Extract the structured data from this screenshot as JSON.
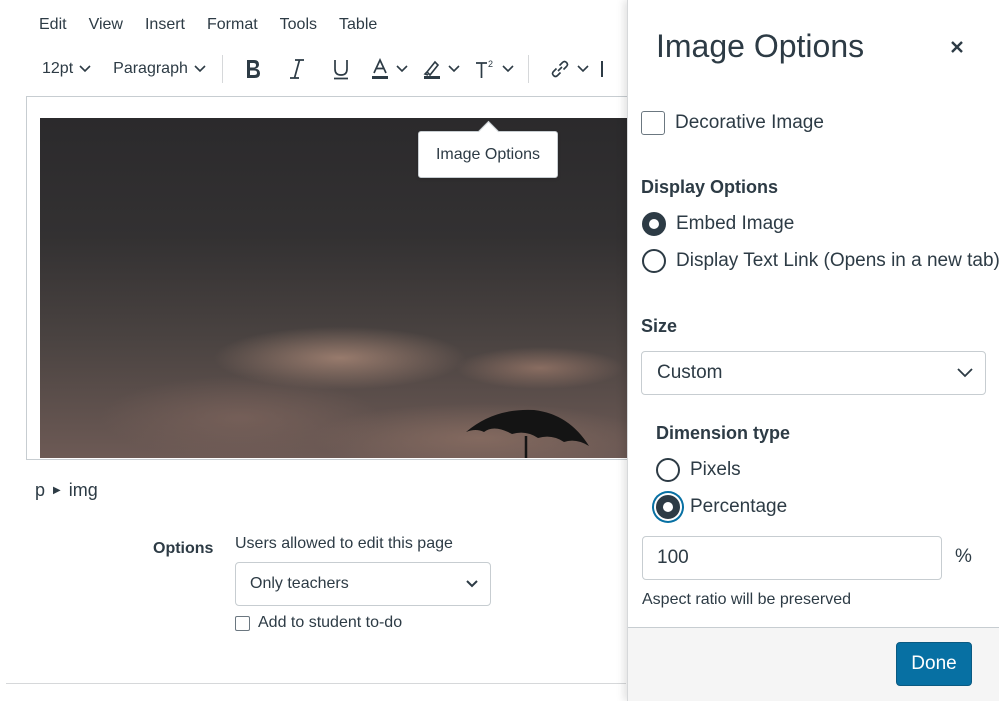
{
  "menubar": {
    "items": [
      "Edit",
      "View",
      "Insert",
      "Format",
      "Tools",
      "Table"
    ]
  },
  "toolbar": {
    "font_size": "12pt",
    "block_format": "Paragraph",
    "icons": [
      "bold-icon",
      "italic-icon",
      "underline-icon",
      "text-color-icon",
      "highlight-color-icon",
      "superscript-icon",
      "link-icon"
    ]
  },
  "tooltip": {
    "text": "Image Options"
  },
  "path": {
    "parent": "p",
    "child": "img"
  },
  "options": {
    "label": "Options",
    "description": "Users allowed to edit this page",
    "select_value": "Only teachers",
    "todo_label": "Add to student to-do"
  },
  "tray": {
    "title": "Image Options",
    "decorative_label": "Decorative Image",
    "display_heading": "Display Options",
    "display_embed": "Embed Image",
    "display_link": "Display Text Link (Opens in a new tab)",
    "size_heading": "Size",
    "size_value": "Custom",
    "dimension_heading": "Dimension type",
    "dim_pixels": "Pixels",
    "dim_percentage": "Percentage",
    "percentage_value": "100",
    "percentage_unit": "%",
    "aspect_note": "Aspect ratio will be preserved",
    "done_label": "Done"
  },
  "colors": {
    "text": "#2d3b45",
    "primary": "#0770a3",
    "border": "#c7cdd1",
    "footer_bg": "#f5f5f5"
  }
}
